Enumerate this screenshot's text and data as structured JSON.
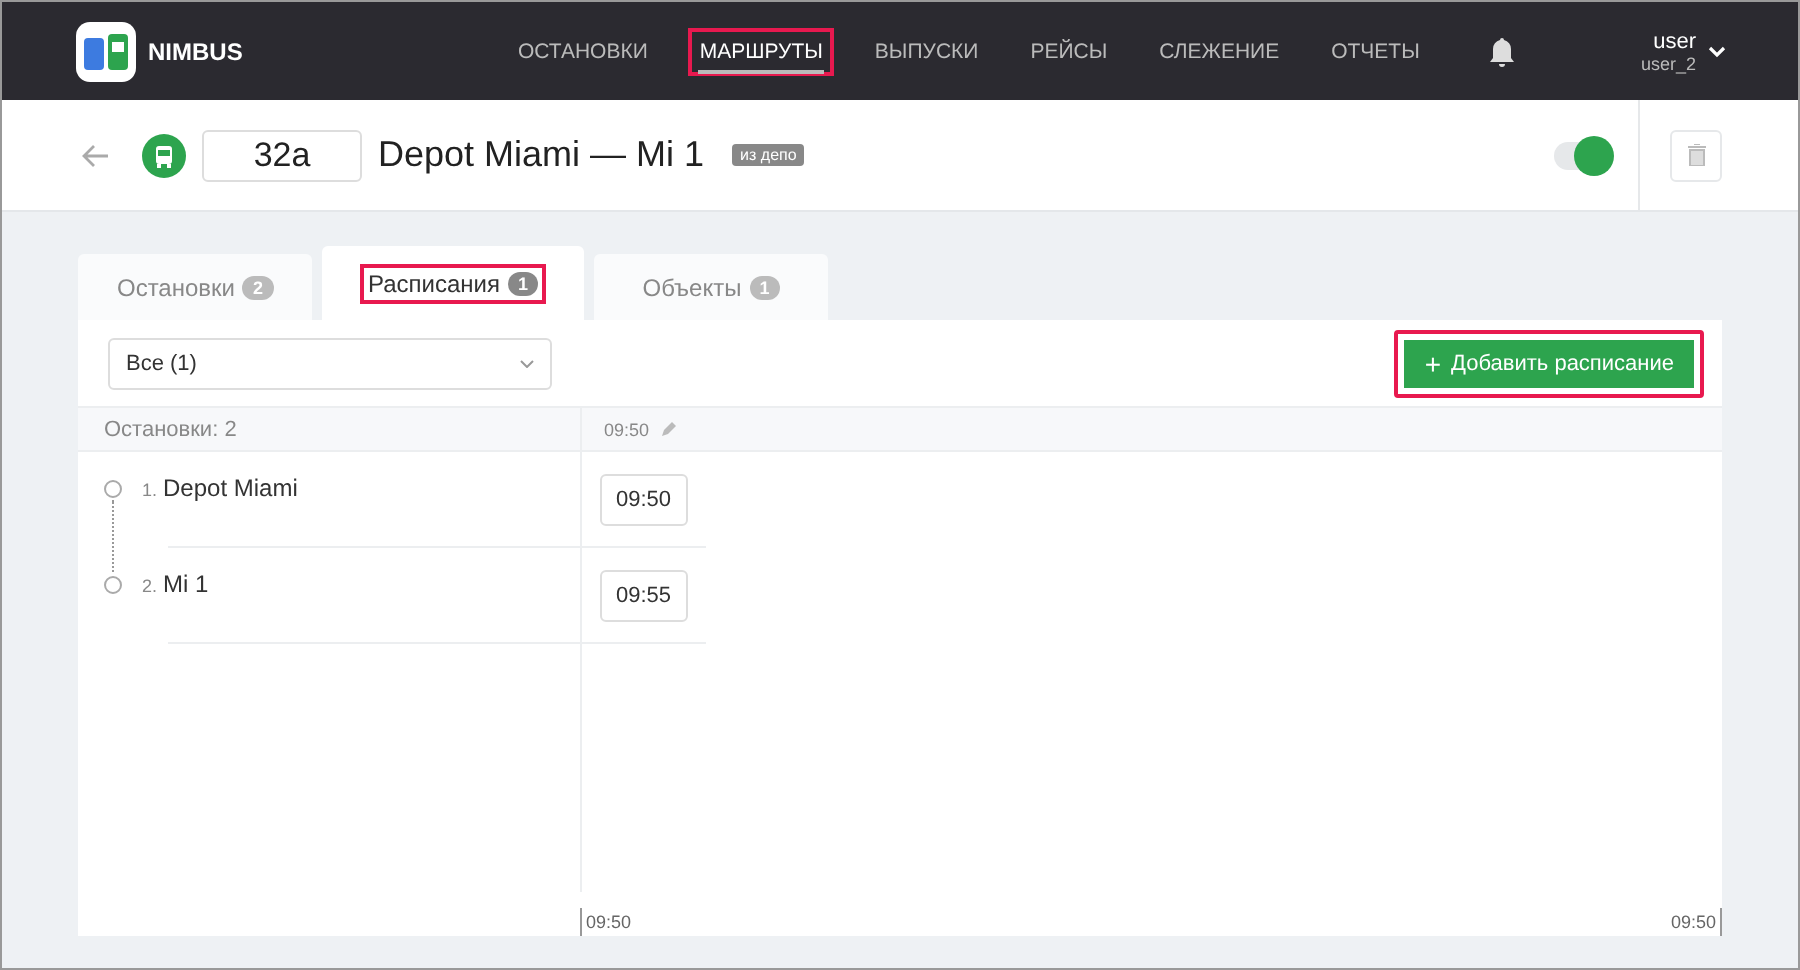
{
  "app": {
    "name": "NIMBUS"
  },
  "nav": [
    {
      "label": "ОСТАНОВКИ",
      "selected": false,
      "highlighted": false
    },
    {
      "label": "МАРШРУТЫ",
      "selected": true,
      "highlighted": true
    },
    {
      "label": "ВЫПУСКИ",
      "selected": false,
      "highlighted": false
    },
    {
      "label": "РЕЙСЫ",
      "selected": false,
      "highlighted": false
    },
    {
      "label": "СЛЕЖЕНИЕ",
      "selected": false,
      "highlighted": false
    },
    {
      "label": "ОТЧЕТЫ",
      "selected": false,
      "highlighted": false
    }
  ],
  "user": {
    "name": "user",
    "login": "user_2"
  },
  "route": {
    "number": "32a",
    "title": "Depot Miami — Mi 1",
    "badge": "из депо",
    "active": true
  },
  "tabs": [
    {
      "label": "Остановки",
      "count": "2",
      "selected": false,
      "highlighted": false
    },
    {
      "label": "Расписания",
      "count": "1",
      "selected": true,
      "highlighted": true
    },
    {
      "label": "Объекты",
      "count": "1",
      "selected": false,
      "highlighted": false
    }
  ],
  "filter": {
    "value": "Все (1)"
  },
  "add_button": {
    "icon": "+",
    "label": "Добавить расписание",
    "highlighted": true
  },
  "stops_header": "Остановки: 2",
  "schedule_header": {
    "time": "09:50"
  },
  "stops": [
    {
      "index": "1.",
      "name": "Depot Miami",
      "time": "09:50"
    },
    {
      "index": "2.",
      "name": "Mi 1",
      "time": "09:55"
    }
  ],
  "timeline": {
    "start": "09:50",
    "end": "09:50"
  }
}
